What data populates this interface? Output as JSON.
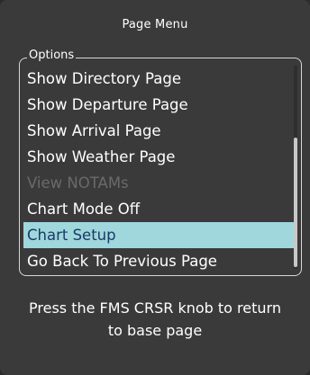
{
  "window": {
    "title": "Page Menu"
  },
  "options": {
    "label": "Options",
    "items": [
      {
        "label": "Show Directory Page"
      },
      {
        "label": "Show Departure Page"
      },
      {
        "label": "Show Arrival Page"
      },
      {
        "label": "Show Weather Page"
      },
      {
        "label": "View NOTAMs"
      },
      {
        "label": "Chart Mode Off"
      },
      {
        "label": "Chart Setup"
      },
      {
        "label": "Go Back To Previous Page"
      }
    ]
  },
  "footer": {
    "line1": "Press the FMS CRSR knob to return",
    "line2": "to base page"
  },
  "colors": {
    "background": "#3a3a3a",
    "selected_background": "#9fd7dc",
    "selected_text": "#1a3a66",
    "disabled_text": "#6a6a6a"
  }
}
